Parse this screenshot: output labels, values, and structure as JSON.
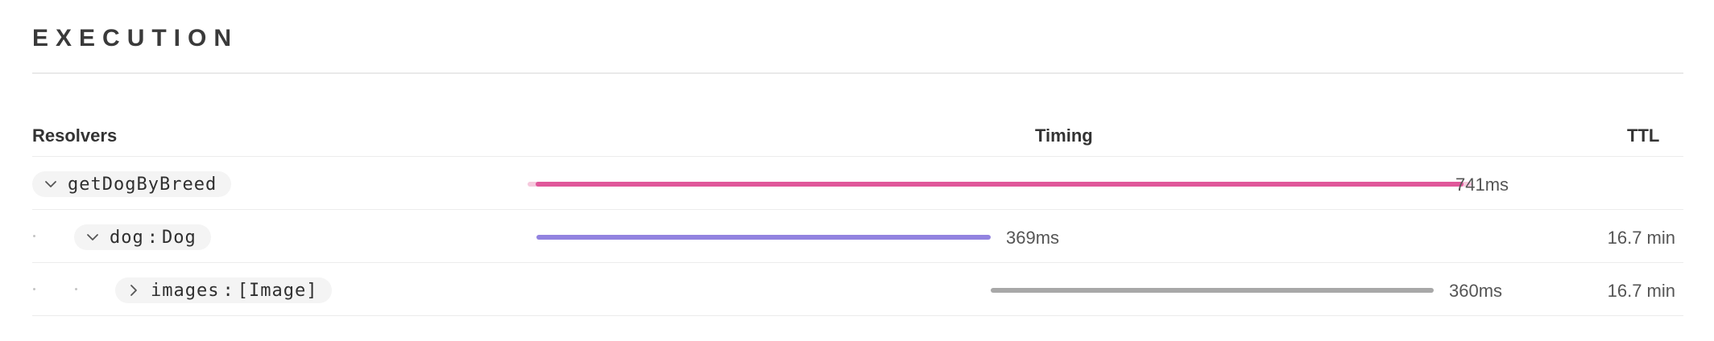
{
  "section": {
    "title": "EXECUTION"
  },
  "table": {
    "headers": {
      "resolvers": "Resolvers",
      "timing": "Timing",
      "ttl": "TTL"
    },
    "rows": [
      {
        "field": "getDogByBreed",
        "type": "",
        "expanded": true,
        "chevron_icon": "chevron-down-icon",
        "duration": "741ms",
        "ttl": "",
        "bar_color": "#e0579a",
        "track_color": "#f6c9dd"
      },
      {
        "field": "dog",
        "sep": ":",
        "type": "Dog",
        "expanded": true,
        "chevron_icon": "chevron-down-icon",
        "duration": "369ms",
        "ttl": "16.7 min",
        "bar_color": "#9283e0"
      },
      {
        "field": "images",
        "sep": ":",
        "type": "[Image]",
        "expanded": false,
        "chevron_icon": "chevron-right-icon",
        "duration": "360ms",
        "ttl": "16.7 min",
        "bar_color": "#a8a8a8"
      }
    ]
  }
}
